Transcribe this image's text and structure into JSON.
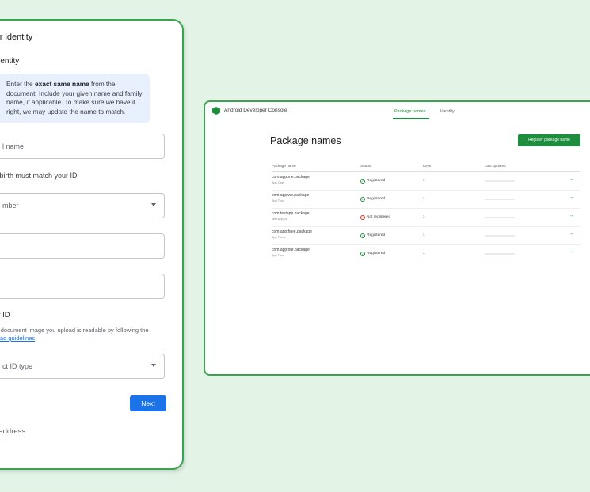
{
  "form": {
    "title": "your identity",
    "subtitle": "al identity",
    "info": {
      "pre": "Enter the ",
      "bold": "exact same name",
      "post": " from the document. Include your given name and family name, if applicable. To make sure we have it right, we may update the name to match."
    },
    "name_placeholder": "l name",
    "dob_label": "e of birth must match your ID",
    "month_value": "mber",
    "id_section": "your ID",
    "id_help_line1": "e the document image you upload is readable by following the",
    "id_help_link": "l upload guidelines",
    "id_help_end": ".",
    "id_type_placeholder": "ct ID type",
    "next_label": "Next",
    "address_section": "our address"
  },
  "console": {
    "app_title": "Android Developer Console",
    "tabs": [
      {
        "label": "Package names",
        "active": true
      },
      {
        "label": "Identity",
        "active": false
      }
    ],
    "page_title": "Package names",
    "register_button": "Register package name",
    "columns": [
      "Package name",
      "Status",
      "Keys",
      "Last updated"
    ],
    "rows": [
      {
        "package": "com.appone.package",
        "app": "App One",
        "status": "Registered",
        "keys": "1"
      },
      {
        "package": "com.apptwo.package",
        "app": "App Two",
        "status": "Registered",
        "keys": "1"
      },
      {
        "package": "com.testapp.package",
        "app": "Test App 01",
        "status": "Not registered",
        "keys": "1"
      },
      {
        "package": "com.appthree.package",
        "app": "App Three",
        "status": "Registered",
        "keys": "1"
      },
      {
        "package": "com.appfour.package",
        "app": "App Four",
        "status": "Registered",
        "keys": "1"
      }
    ],
    "colors": {
      "accent": "#1e8e3e",
      "registered": "#1e8e3e",
      "not_registered": "#d93025"
    }
  }
}
